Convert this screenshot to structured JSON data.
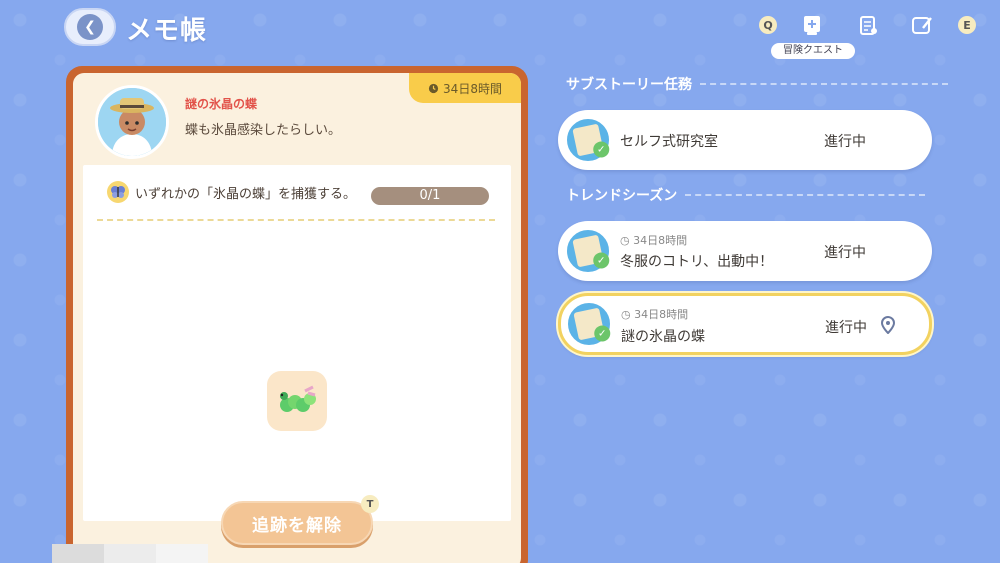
{
  "header": {
    "title": "メモ帳",
    "keys": {
      "left": "Q",
      "right": "E"
    },
    "tooltip": "冒険クエスト"
  },
  "left_panel": {
    "time_remaining": "34日8時間",
    "quest_name": "謎の氷晶の蝶",
    "quest_description": "蝶も氷晶感染したらしい。",
    "objective": {
      "text": "いずれかの「氷晶の蝶」を捕獲する。",
      "progress_text": "0/1",
      "progress_fraction": 0
    },
    "untrack_button": "追跡を解除",
    "untrack_key": "T"
  },
  "right_panel": {
    "sections": [
      {
        "header": "サブストーリー任務",
        "quests": [
          {
            "time": "",
            "title": "セルフ式研究室",
            "status": "進行中",
            "selected": false
          }
        ]
      },
      {
        "header": "トレンドシーズン",
        "quests": [
          {
            "time": "34日8時間",
            "title": "冬服のコトリ、出動中！",
            "status": "進行中",
            "selected": false
          },
          {
            "time": "34日8時間",
            "title": "謎の氷晶の蝶",
            "status": "進行中",
            "selected": true
          }
        ]
      }
    ]
  },
  "colors": {
    "background": "#86a8ee",
    "card_border": "#c9652f",
    "accent_red": "#e2534a",
    "badge_yellow": "#f9cc4a"
  }
}
